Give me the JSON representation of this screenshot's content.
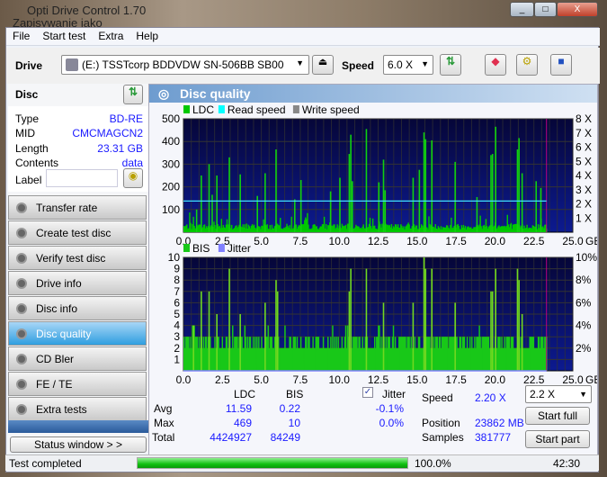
{
  "window": {
    "title": "Opti Drive Control 1.70",
    "background_title": "Zapisywanie jako"
  },
  "menu": [
    "File",
    "Start test",
    "Extra",
    "Help"
  ],
  "toolbar": {
    "drive_label": "Drive",
    "drive_value": "(E:)  TSSTcorp BDDVDW SN-506BB SB00",
    "speed_label": "Speed",
    "speed_value": "6.0 X"
  },
  "disc": {
    "header": "Disc",
    "type_label": "Type",
    "type": "BD-RE",
    "mid_label": "MID",
    "mid": "CMCMAGCN2",
    "length_label": "Length",
    "length": "23.31 GB",
    "contents_label": "Contents",
    "contents": "data",
    "label_label": "Label",
    "label_value": ""
  },
  "nav": [
    {
      "label": "Transfer rate"
    },
    {
      "label": "Create test disc"
    },
    {
      "label": "Verify test disc"
    },
    {
      "label": "Drive info"
    },
    {
      "label": "Disc info"
    },
    {
      "label": "Disc quality",
      "active": true
    },
    {
      "label": "CD Bler"
    },
    {
      "label": "FE / TE"
    },
    {
      "label": "Extra tests"
    }
  ],
  "status_window_label": "Status window > >",
  "panel_title": "Disc quality",
  "stats": {
    "col_ldc": "LDC",
    "col_bis": "BIS",
    "jitter_label": "Jitter",
    "jitter_checked": true,
    "avg_label": "Avg",
    "avg_ldc": "11.59",
    "avg_bis": "0.22",
    "avg_jitter": "-0.1%",
    "max_label": "Max",
    "max_ldc": "469",
    "max_bis": "10",
    "max_jitter": "0.0%",
    "total_label": "Total",
    "total_ldc": "4424927",
    "total_bis": "84249",
    "speed_label": "Speed",
    "speed_value": "2.20 X",
    "position_label": "Position",
    "position_value": "23862 MB",
    "samples_label": "Samples",
    "samples_value": "381777",
    "speed_select": "2.2 X",
    "start_full": "Start full",
    "start_part": "Start part"
  },
  "statusbar": {
    "text": "Test completed",
    "progress": 100.0,
    "progress_text": "100.0%",
    "time": "42:30"
  },
  "colors": {
    "ldc": "#00c800",
    "read_speed": "#00ffff",
    "write_speed": "#888888",
    "bis": "#00c800",
    "jitter": "#8080ff",
    "plot_bg": "#0a0a5a",
    "end_marker": "#c00080"
  },
  "chart_data": [
    {
      "type": "bar",
      "legend": [
        "LDC",
        "Read speed",
        "Write speed"
      ],
      "xlabel_unit": "GB",
      "xlim": [
        0,
        25
      ],
      "ylim": [
        0,
        500
      ],
      "y2lim": [
        0,
        8
      ],
      "xticks": [
        "0.0",
        "2.5",
        "5.0",
        "7.5",
        "10.0",
        "12.5",
        "15.0",
        "17.5",
        "20.0",
        "22.5",
        "25.0"
      ],
      "yticks": [
        "100",
        "200",
        "300",
        "400",
        "500"
      ],
      "y2ticks": [
        "1 X",
        "2 X",
        "3 X",
        "4 X",
        "5 X",
        "6 X",
        "7 X",
        "8 X"
      ],
      "data_end_gb": 23.31,
      "read_speed_x": 2.2,
      "baseline_ldc": 25,
      "spikes": [
        [
          0.8,
          100
        ],
        [
          1.1,
          250
        ],
        [
          1.6,
          300
        ],
        [
          1.8,
          165
        ],
        [
          2.1,
          250
        ],
        [
          2.9,
          330
        ],
        [
          3.6,
          255
        ],
        [
          4.7,
          160
        ],
        [
          5.2,
          260
        ],
        [
          5.9,
          365
        ],
        [
          7.1,
          145
        ],
        [
          7.5,
          230
        ],
        [
          9.4,
          180
        ],
        [
          10.0,
          240
        ],
        [
          10.6,
          345
        ],
        [
          10.7,
          430
        ],
        [
          10.8,
          225
        ],
        [
          11.7,
          455
        ],
        [
          12.5,
          220
        ],
        [
          12.8,
          320
        ],
        [
          12.9,
          185
        ],
        [
          14.7,
          240
        ],
        [
          15.1,
          275
        ],
        [
          15.4,
          440
        ],
        [
          15.5,
          410
        ],
        [
          15.9,
          405
        ],
        [
          17.4,
          310
        ],
        [
          18.8,
          155
        ],
        [
          19.7,
          340
        ],
        [
          19.8,
          345
        ],
        [
          20.0,
          465
        ],
        [
          21.4,
          365
        ],
        [
          21.5,
          415
        ],
        [
          21.7,
          260
        ],
        [
          22.6,
          225
        ],
        [
          22.9,
          195
        ]
      ]
    },
    {
      "type": "bar",
      "legend": [
        "BIS",
        "Jitter"
      ],
      "xlabel_unit": "GB",
      "xlim": [
        0,
        25
      ],
      "ylim": [
        0,
        10
      ],
      "y2lim": [
        0,
        10
      ],
      "xticks": [
        "0.0",
        "2.5",
        "5.0",
        "7.5",
        "10.0",
        "12.5",
        "15.0",
        "17.5",
        "20.0",
        "22.5",
        "25.0"
      ],
      "yticks": [
        "1",
        "2",
        "3",
        "4",
        "5",
        "6",
        "7",
        "8",
        "9",
        "10"
      ],
      "y2ticks": [
        "2%",
        "4%",
        "6%",
        "8%",
        "10%"
      ],
      "data_end_gb": 23.31,
      "baseline_bis": 2,
      "spikes": [
        [
          0.6,
          4
        ],
        [
          1.1,
          7
        ],
        [
          1.6,
          7
        ],
        [
          2.1,
          5
        ],
        [
          2.9,
          9
        ],
        [
          3.6,
          5
        ],
        [
          5.2,
          6
        ],
        [
          5.9,
          8
        ],
        [
          6.0,
          7
        ],
        [
          10.6,
          7
        ],
        [
          10.7,
          9
        ],
        [
          11.7,
          9
        ],
        [
          12.8,
          6
        ],
        [
          14.7,
          6
        ],
        [
          15.4,
          10
        ],
        [
          15.5,
          9
        ],
        [
          15.9,
          9
        ],
        [
          17.4,
          6
        ],
        [
          19.7,
          7
        ],
        [
          19.8,
          7
        ],
        [
          20.0,
          9
        ],
        [
          21.4,
          9
        ],
        [
          21.5,
          8
        ],
        [
          21.7,
          5
        ]
      ]
    }
  ]
}
